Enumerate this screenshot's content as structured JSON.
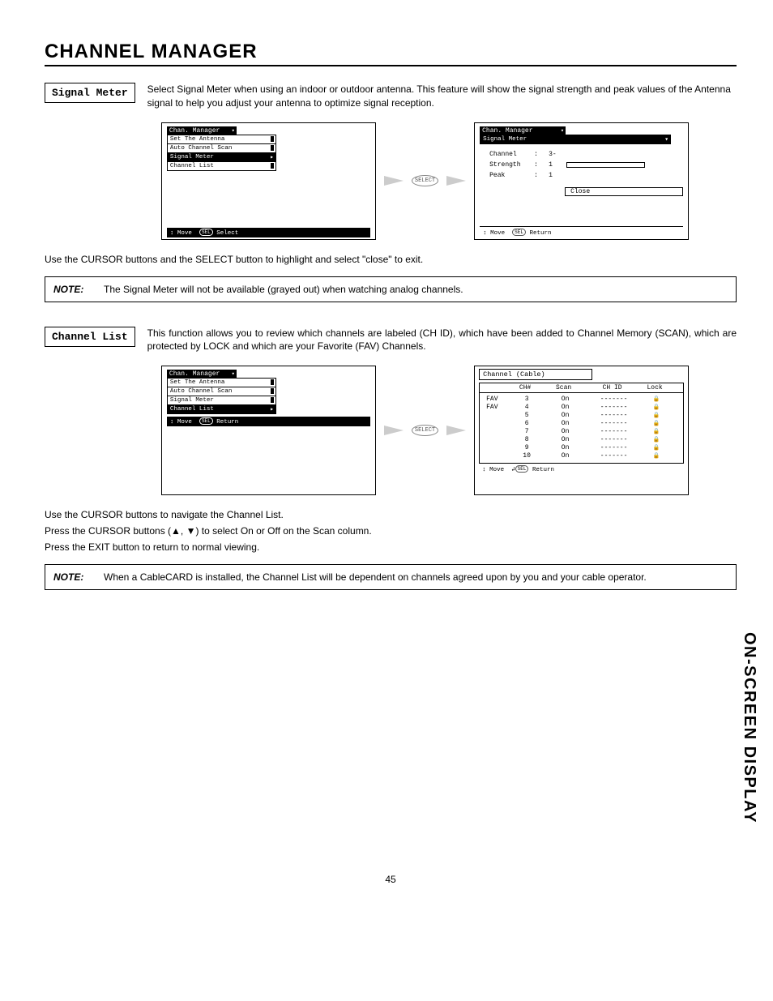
{
  "page_title": "CHANNEL MANAGER",
  "side_label": "ON-SCREEN DISPLAY",
  "page_number": "45",
  "signal_meter": {
    "label": "Signal Meter",
    "desc": "Select Signal Meter when using an indoor or outdoor antenna.  This feature will show the signal strength and peak values of the Antenna signal to help  you adjust your antenna to optimize signal reception.",
    "menu": {
      "header": "Chan. Manager",
      "items": [
        "Set The Antenna",
        "Auto Channel Scan",
        "Signal Meter",
        "Channel List"
      ],
      "selected": 2,
      "hint": "Move",
      "hint2": "Select"
    },
    "result": {
      "header": "Chan. Manager",
      "sub": "Signal Meter",
      "rows": [
        {
          "label": "Channel",
          "value": "3-"
        },
        {
          "label": "Strength",
          "value": "1"
        },
        {
          "label": "Peak",
          "value": "1"
        }
      ],
      "close": "Close",
      "hint": "Move",
      "hint2": "Return"
    },
    "exit_text": "Use the CURSOR buttons and the SELECT button to highlight and select \"close\" to exit.",
    "note_label": "NOTE:",
    "note_text": "The Signal Meter will not be available (grayed out) when watching analog channels."
  },
  "channel_list": {
    "label": "Channel List",
    "desc": "This function allows you to review which channels are labeled (CH ID), which have been added to Channel Memory (SCAN), which are protected by LOCK and which are your Favorite (FAV) Channels.",
    "menu": {
      "header": "Chan. Manager",
      "items": [
        "Set The Antenna",
        "Auto Channel Scan",
        "Signal Meter",
        "Channel List"
      ],
      "selected": 3,
      "hint": "Move",
      "hint2": "Return"
    },
    "table": {
      "title": "Channel (Cable)",
      "headers": [
        "CH#",
        "Scan",
        "CH ID",
        "Lock"
      ],
      "rows": [
        {
          "fav": "FAV",
          "ch": "3",
          "scan": "On",
          "id": "-------",
          "lock": "🔒"
        },
        {
          "fav": "FAV",
          "ch": "4",
          "scan": "On",
          "id": "-------",
          "lock": "🔒"
        },
        {
          "fav": "",
          "ch": "5",
          "scan": "On",
          "id": "-------",
          "lock": "🔒"
        },
        {
          "fav": "",
          "ch": "6",
          "scan": "On",
          "id": "-------",
          "lock": "🔒"
        },
        {
          "fav": "",
          "ch": "7",
          "scan": "On",
          "id": "-------",
          "lock": "🔒"
        },
        {
          "fav": "",
          "ch": "8",
          "scan": "On",
          "id": "-------",
          "lock": "🔒"
        },
        {
          "fav": "",
          "ch": "9",
          "scan": "On",
          "id": "-------",
          "lock": "🔒"
        },
        {
          "fav": "",
          "ch": "10",
          "scan": "On",
          "id": "-------",
          "lock": "🔒"
        }
      ],
      "hint": "Move",
      "hint2": "Return"
    },
    "nav_text1": "Use the CURSOR buttons to navigate the Channel List.",
    "nav_text2": "Press the CURSOR buttons (▲, ▼) to select On or Off on the Scan column.",
    "nav_text3": "Press the EXIT button to return to normal viewing.",
    "note_label": "NOTE:",
    "note_text": "When a CableCARD is installed, the Channel List will be dependent on channels agreed upon by you and your cable operator."
  },
  "select_btn": "SELECT"
}
